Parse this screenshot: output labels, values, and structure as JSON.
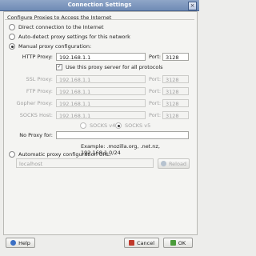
{
  "window": {
    "title": "Connection Settings",
    "close_glyph": "×"
  },
  "group_title": "Configure Proxies to Access the Internet",
  "modes": [
    {
      "label": "Direct connection to the Internet",
      "selected": false
    },
    {
      "label": "Auto-detect proxy settings for this network",
      "selected": false
    },
    {
      "label": "Manual proxy configuration:",
      "selected": true
    }
  ],
  "manual": {
    "http_label": "HTTP Proxy:",
    "http_value": "192.168.1.1",
    "port_label": "Port:",
    "http_port": "3128",
    "same_proxy_label": "Use this proxy server for all protocols",
    "same_proxy_checked": true,
    "ssl_label": "SSL Proxy:",
    "ssl_value": "192.168.1.1",
    "ssl_port": "3128",
    "ftp_label": "FTP Proxy:",
    "ftp_value": "192.168.1.1",
    "ftp_port": "3128",
    "gopher_label": "Gopher Proxy:",
    "gopher_value": "192.168.1.1",
    "gopher_port": "3128",
    "socks_label": "SOCKS Host:",
    "socks_value": "192.168.1.1",
    "socks_port": "3128",
    "socks_v4": "SOCKS v4",
    "socks_v5": "SOCKS v5",
    "no_proxy_label": "No Proxy for:",
    "no_proxy_value": "",
    "example": "Example:  .mozilla.org, .net.nz, 192.168.1.0/24"
  },
  "auto_config": {
    "label": "Automatic proxy configuration URL:",
    "url": "localhost",
    "reload_label": "Reload"
  },
  "buttons": {
    "help": "Help",
    "cancel": "Cancel",
    "ok": "OK"
  },
  "icons": {
    "help": "help-icon",
    "cancel": "cancel-icon",
    "ok": "ok-icon",
    "reload": "reload-icon"
  }
}
